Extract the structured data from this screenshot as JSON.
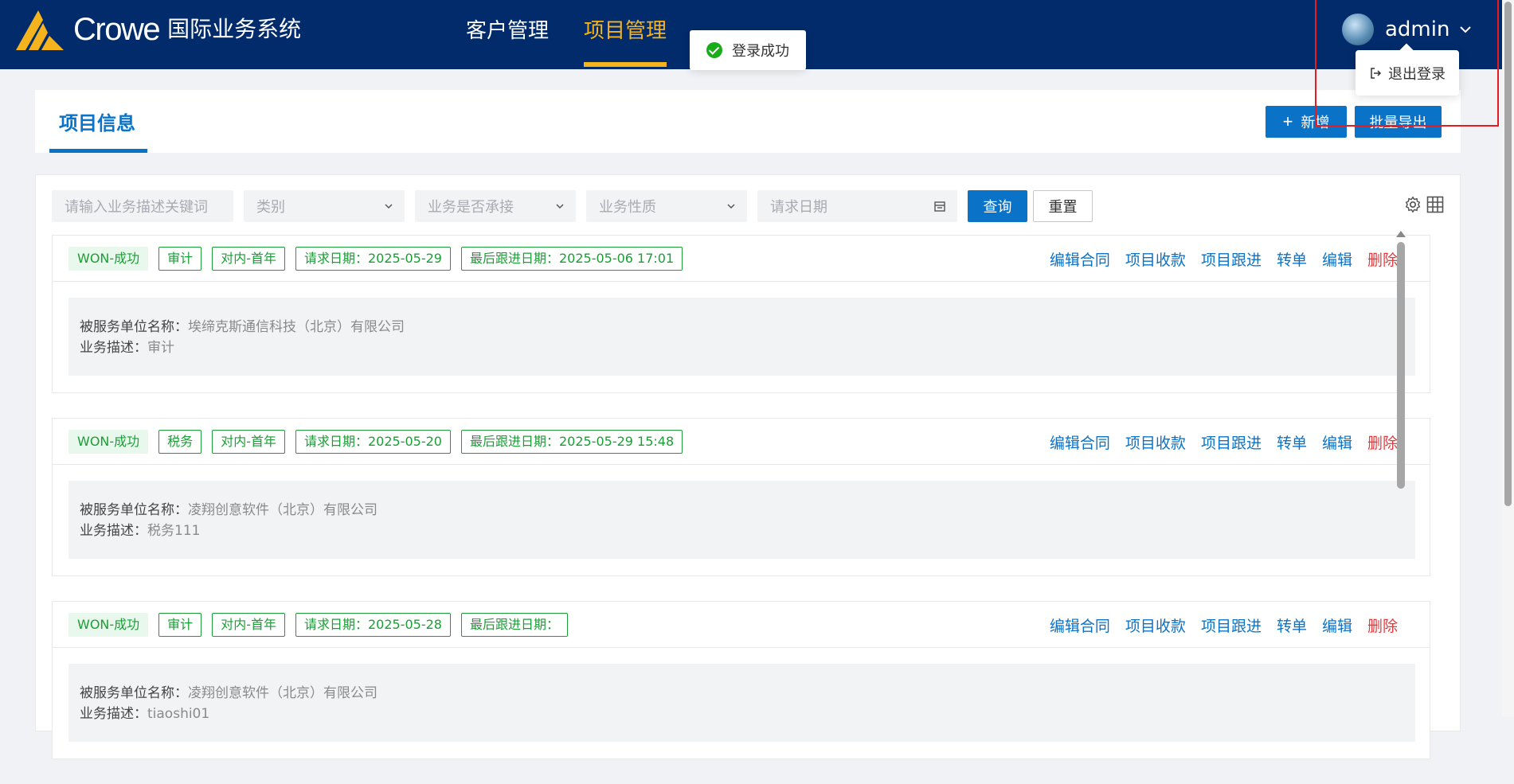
{
  "header": {
    "logo_text": "Crowe",
    "system_name": "国际业务系统",
    "nav": [
      {
        "label": "客户管理"
      },
      {
        "label": "项目管理"
      }
    ],
    "user_name": "admin",
    "dropdown_item": "退出登录"
  },
  "toast": {
    "message": "登录成功"
  },
  "page": {
    "title": "项目信息",
    "new_button": "新增",
    "export_button": "批量导出"
  },
  "filters": {
    "keyword_placeholder": "请输入业务描述关键词",
    "category_placeholder": "类别",
    "accepted_placeholder": "业务是否承接",
    "nature_placeholder": "业务性质",
    "date_placeholder": "请求日期",
    "query_button": "查询",
    "reset_button": "重置"
  },
  "labels": {
    "client_name": "被服务单位名称：",
    "description": "业务描述："
  },
  "actions": [
    "编辑合同",
    "项目收款",
    "项目跟进",
    "转单",
    "编辑",
    "删除"
  ],
  "projects": [
    {
      "status": "WON-成功",
      "type": "审计",
      "nature": "对内-首年",
      "request_date": "请求日期：2025-05-29",
      "last_follow": "最后跟进日期：2025-05-06 17:01",
      "client": "埃缔克斯通信科技（北京）有限公司",
      "description": "审计"
    },
    {
      "status": "WON-成功",
      "type": "税务",
      "nature": "对内-首年",
      "request_date": "请求日期：2025-05-20",
      "last_follow": "最后跟进日期：2025-05-29 15:48",
      "client": "凌翔创意软件（北京）有限公司",
      "description": "税务111"
    },
    {
      "status": "WON-成功",
      "type": "审计",
      "nature": "对内-首年",
      "request_date": "请求日期：2025-05-28",
      "last_follow": "最后跟进日期：",
      "client": "凌翔创意软件（北京）有限公司",
      "description": "tiaoshi01"
    }
  ],
  "colors": {
    "header_bg": "#012b6b",
    "accent_yellow": "#f5b41d",
    "primary_blue": "#0b73c7",
    "success_green": "#1a9e35",
    "danger_red": "#e4393c"
  }
}
